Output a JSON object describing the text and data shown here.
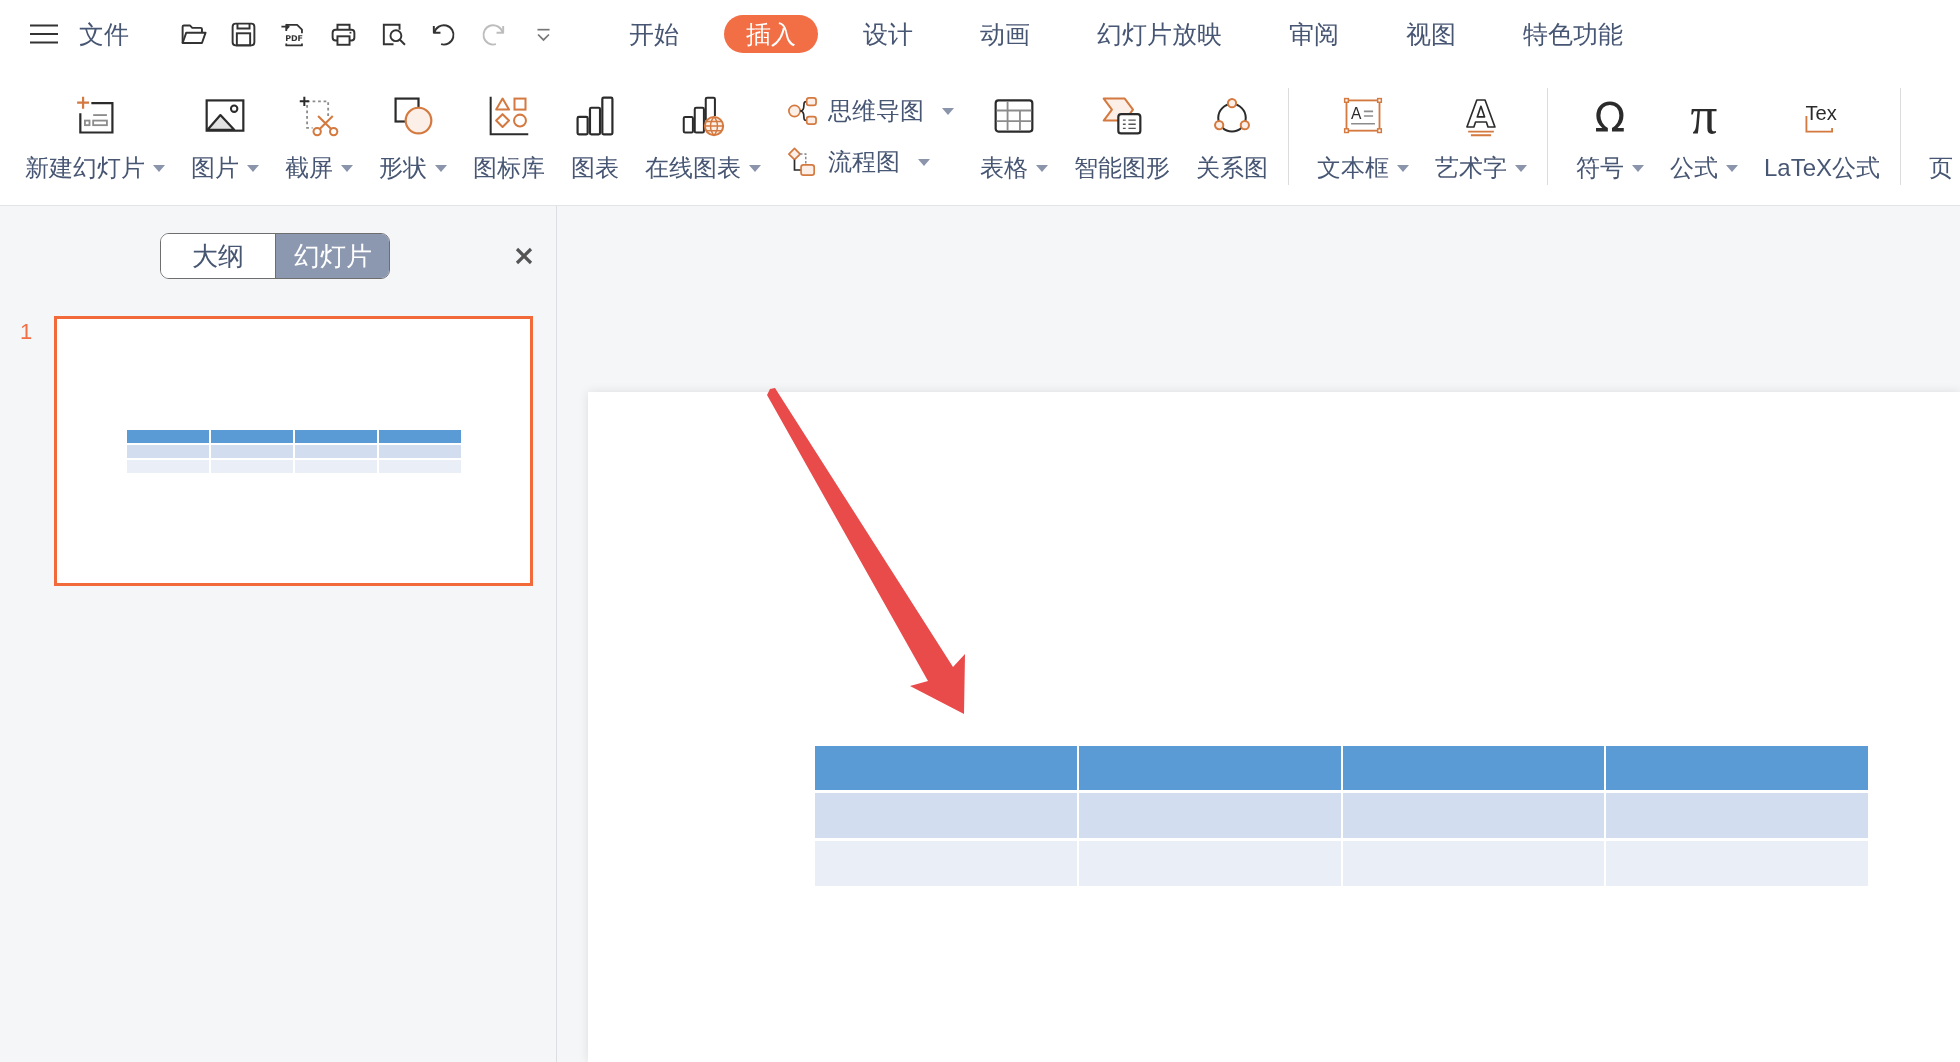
{
  "menu_bar": {
    "menu_label": "文件",
    "quick_access": [
      {
        "disabled": false
      },
      {
        "disabled": false
      },
      {
        "icon_text": "PDF",
        "disabled": false
      },
      {
        "disabled": false
      },
      {
        "disabled": false
      },
      {
        "disabled": false
      },
      {
        "disabled": true
      },
      {
        "disabled": false
      }
    ],
    "tabs": [
      {
        "label": "开始",
        "selected": false
      },
      {
        "label": "插入",
        "selected": true
      },
      {
        "label": "设计",
        "selected": false
      },
      {
        "label": "动画",
        "selected": false
      },
      {
        "label": "幻灯片放映",
        "selected": false
      },
      {
        "label": "审阅",
        "selected": false
      },
      {
        "label": "视图",
        "selected": false
      },
      {
        "label": "特色功能",
        "selected": false
      }
    ]
  },
  "ribbon": {
    "groups": [
      {
        "items": [
          {
            "kind": "large",
            "label": "新建幻灯片",
            "dropdown": true
          },
          {
            "kind": "large",
            "label": "图片",
            "dropdown": true
          },
          {
            "kind": "large",
            "label": "截屏",
            "dropdown": true
          },
          {
            "kind": "large",
            "label": "形状",
            "dropdown": true
          },
          {
            "kind": "large",
            "label": "图标库",
            "dropdown": false
          },
          {
            "kind": "large",
            "label": "图表",
            "dropdown": false
          },
          {
            "kind": "large",
            "label": "在线图表",
            "dropdown": true
          },
          {
            "kind": "stack",
            "entries": [
              {
                "label": "思维导图",
                "dropdown": true
              },
              {
                "label": "流程图",
                "dropdown": true
              }
            ]
          },
          {
            "kind": "large",
            "label": "表格",
            "dropdown": true
          },
          {
            "kind": "large",
            "label": "智能图形",
            "dropdown": false
          },
          {
            "kind": "large",
            "label": "关系图",
            "dropdown": false
          }
        ]
      },
      {
        "items": [
          {
            "kind": "large",
            "label": "文本框",
            "dropdown": true,
            "icon_text": "A"
          },
          {
            "kind": "large",
            "label": "艺术字",
            "dropdown": true,
            "icon_text": "A"
          }
        ]
      },
      {
        "items": [
          {
            "kind": "large",
            "label": "符号",
            "dropdown": true,
            "icon_text": "Ω"
          },
          {
            "kind": "large",
            "label": "公式",
            "dropdown": true,
            "icon_text": "π"
          },
          {
            "kind": "large",
            "label": "LaTeX公式",
            "dropdown": false,
            "icon_text": "Tex"
          }
        ]
      },
      {
        "items": [
          {
            "kind": "label_only",
            "label": "页",
            "dropdown": false
          }
        ]
      }
    ]
  },
  "slide_panel": {
    "view_tabs": [
      {
        "label": "大纲",
        "selected": false
      },
      {
        "label": "幻灯片",
        "selected": true
      }
    ],
    "slides": [
      {
        "number": "1",
        "selected": true,
        "table": {
          "rows": [
            {
              "kind": "header",
              "cells": [
                {
                  "kind": "blank"
                },
                {
                  "kind": "blank"
                },
                {
                  "kind": "blank"
                },
                {
                  "kind": "blank"
                }
              ]
            },
            {
              "kind": "band_dark",
              "cells": [
                {
                  "kind": "blank"
                },
                {
                  "kind": "blank"
                },
                {
                  "kind": "blank"
                },
                {
                  "kind": "blank"
                }
              ]
            },
            {
              "kind": "band_light",
              "cells": [
                {
                  "kind": "blank"
                },
                {
                  "kind": "blank"
                },
                {
                  "kind": "blank"
                },
                {
                  "kind": "blank"
                }
              ]
            }
          ]
        }
      }
    ]
  },
  "editor": {
    "slide": {
      "table": {
        "rows": [
          {
            "kind": "header",
            "cells": [
              {
                "kind": "blank"
              },
              {
                "kind": "blank"
              },
              {
                "kind": "blank"
              },
              {
                "kind": "blank"
              }
            ]
          },
          {
            "kind": "band_dark",
            "cells": [
              {
                "kind": "blank"
              },
              {
                "kind": "blank"
              },
              {
                "kind": "blank"
              },
              {
                "kind": "blank"
              }
            ]
          },
          {
            "kind": "band_light",
            "cells": [
              {
                "kind": "blank"
              },
              {
                "kind": "blank"
              },
              {
                "kind": "blank"
              },
              {
                "kind": "blank"
              }
            ]
          }
        ]
      }
    }
  }
}
